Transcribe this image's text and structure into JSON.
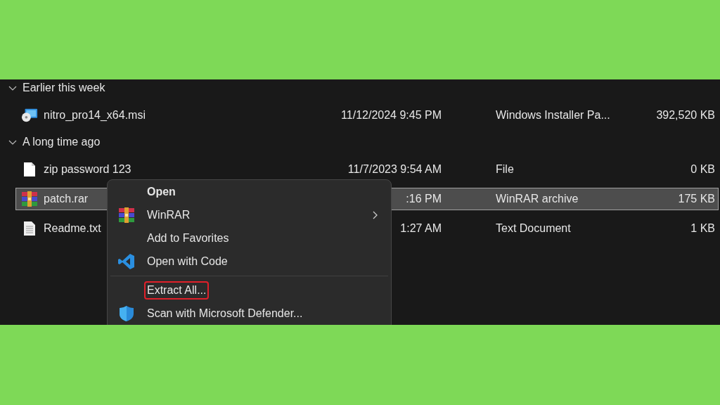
{
  "groups": [
    {
      "label": "Earlier this week",
      "expanded": true,
      "files": [
        {
          "name": "nitro_pro14_x64.msi",
          "kind": "installer",
          "date": "11/12/2024 9:45 PM",
          "type": "Windows Installer Pa...",
          "size": "392,520 KB",
          "selected": false
        }
      ]
    },
    {
      "label": "A long time ago",
      "expanded": true,
      "files": [
        {
          "name": "zip password 123",
          "kind": "blank",
          "date": "11/7/2023 9:54 AM",
          "type": "File",
          "size": "0 KB",
          "selected": false
        },
        {
          "name": "patch.rar",
          "kind": "archive",
          "date": ":16 PM",
          "type": "WinRAR archive",
          "size": "175 KB",
          "selected": true
        },
        {
          "name": "Readme.txt",
          "kind": "text",
          "date": "1:27 AM",
          "type": "Text Document",
          "size": "1 KB",
          "selected": false
        }
      ]
    }
  ],
  "context_menu": {
    "items": [
      {
        "kind": "plain",
        "label": "Open",
        "default": true,
        "submenu": false,
        "highlighted": false
      },
      {
        "kind": "archive",
        "label": "WinRAR",
        "default": false,
        "submenu": true,
        "highlighted": false
      },
      {
        "kind": "plain",
        "label": "Add to Favorites",
        "default": false,
        "submenu": false,
        "highlighted": false
      },
      {
        "kind": "code",
        "label": "Open with Code",
        "default": false,
        "submenu": false,
        "highlighted": false
      },
      {
        "kind": "separator"
      },
      {
        "kind": "plain",
        "label": "Extract All...",
        "default": false,
        "submenu": false,
        "highlighted": true
      },
      {
        "kind": "shield",
        "label": "Scan with Microsoft Defender...",
        "default": false,
        "submenu": false,
        "highlighted": false
      }
    ]
  }
}
